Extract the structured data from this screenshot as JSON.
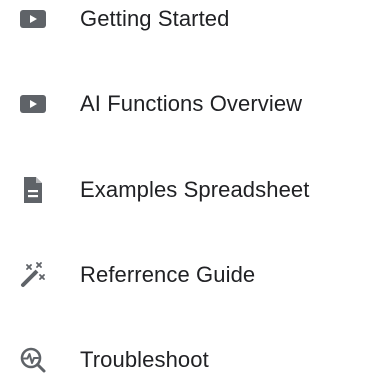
{
  "menu": {
    "items": [
      {
        "label": "Getting Started",
        "icon": "video-icon"
      },
      {
        "label": "AI Functions Overview",
        "icon": "video-icon"
      },
      {
        "label": "Examples Spreadsheet",
        "icon": "document-icon"
      },
      {
        "label": "Referrence Guide",
        "icon": "magic-wand-icon"
      },
      {
        "label": "Troubleshoot",
        "icon": "troubleshoot-icon"
      }
    ]
  },
  "colors": {
    "icon": "#5f6368",
    "text": "#202124",
    "background": "#ffffff"
  }
}
